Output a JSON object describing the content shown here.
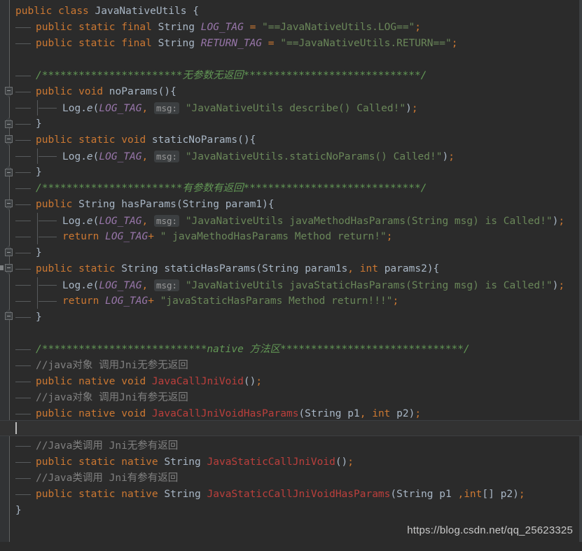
{
  "editor": {
    "theme": "Darcula",
    "file_class": "JavaNativeUtils",
    "colors": {
      "background": "#2B2B2B",
      "gutter": "#313335",
      "caret_line": "#323232",
      "keyword": "#CC7832",
      "string": "#6A8759",
      "comment_block": "#629755",
      "comment_line": "#808080",
      "field_static": "#9876AA",
      "native_method": "#BC3F3C",
      "default_text": "#A9B7C6",
      "param_hint": "#9A9A9A"
    },
    "lines": [
      {
        "n": 1,
        "indent": 0,
        "text": "public class JavaNativeUtils {"
      },
      {
        "n": 2,
        "indent": 1,
        "text": "public static final String LOG_TAG = \"==JavaNativeUtils.LOG==\";"
      },
      {
        "n": 3,
        "indent": 1,
        "text": "public static final String RETURN_TAG = \"==JavaNativeUtils.RETURN==\";"
      },
      {
        "n": 4,
        "indent": 1,
        "text": ""
      },
      {
        "n": 5,
        "indent": 1,
        "text": "/***********************无参数无返回*****************************/"
      },
      {
        "n": 6,
        "indent": 1,
        "text": "public void noParams(){"
      },
      {
        "n": 7,
        "indent": 2,
        "text": "Log.e(LOG_TAG, msg: \"JavaNativeUtils describe() Called!\");"
      },
      {
        "n": 8,
        "indent": 1,
        "text": "}"
      },
      {
        "n": 9,
        "indent": 1,
        "text": "public static void staticNoParams(){"
      },
      {
        "n": 10,
        "indent": 2,
        "text": "Log.e(LOG_TAG, msg: \"JavaNativeUtils.staticNoParams() Called!\");"
      },
      {
        "n": 11,
        "indent": 1,
        "text": "}"
      },
      {
        "n": 12,
        "indent": 1,
        "text": "/***********************有参数有返回*****************************/"
      },
      {
        "n": 13,
        "indent": 1,
        "text": "public String hasParams(String param1){"
      },
      {
        "n": 14,
        "indent": 2,
        "text": "Log.e(LOG_TAG, msg: \"JavaNativeUtils javaMethodHasParams(String msg) is Called!\");"
      },
      {
        "n": 15,
        "indent": 2,
        "text": "return LOG_TAG+ \" javaMethodHasParams Method return!\";"
      },
      {
        "n": 16,
        "indent": 1,
        "text": "}"
      },
      {
        "n": 17,
        "indent": 1,
        "text": "public static String staticHasParams(String param1s, int params2){"
      },
      {
        "n": 18,
        "indent": 2,
        "text": "Log.e(LOG_TAG, msg: \"JavaNativeUtils javaStaticHasParams(String msg) is Called!\");"
      },
      {
        "n": 19,
        "indent": 2,
        "text": "return LOG_TAG+ \"javaStaticHasParams Method return!!!\";"
      },
      {
        "n": 20,
        "indent": 1,
        "text": "}"
      },
      {
        "n": 21,
        "indent": 1,
        "text": ""
      },
      {
        "n": 22,
        "indent": 1,
        "text": "/***************************native 方法区******************************/"
      },
      {
        "n": 23,
        "indent": 1,
        "text": "//java对象 调用Jni无参无返回"
      },
      {
        "n": 24,
        "indent": 1,
        "text": "public native void JavaCallJniVoid();"
      },
      {
        "n": 25,
        "indent": 1,
        "text": "//java对象 调用Jni有参无返回"
      },
      {
        "n": 26,
        "indent": 1,
        "text": "public native void JavaCallJniVoidHasParams(String p1, int p2);"
      },
      {
        "n": 27,
        "indent": 1,
        "text": ""
      },
      {
        "n": 28,
        "indent": 1,
        "text": "//Java类调用 Jni无参有返回"
      },
      {
        "n": 29,
        "indent": 1,
        "text": "public static native String JavaStaticCallJniVoid();"
      },
      {
        "n": 30,
        "indent": 1,
        "text": "//Java类调用 Jni有参有返回"
      },
      {
        "n": 31,
        "indent": 1,
        "text": "public static native String JavaStaticCallJniVoidHasParams(String p1 ,int[] p2);"
      },
      {
        "n": 32,
        "indent": 0,
        "text": "}"
      }
    ],
    "tokens": {
      "l1": {
        "kw": "public",
        "kw2": "class",
        "cls": "JavaNativeUtils",
        "brace": "{"
      },
      "l2": {
        "kw": "public static final",
        "type": "String",
        "field": "LOG_TAG",
        "eq": "=",
        "str": "\"==JavaNativeUtils.LOG==\"",
        "semi": ";"
      },
      "l3": {
        "kw": "public static final",
        "type": "String",
        "field": "RETURN_TAG",
        "eq": "=",
        "str": "\"==JavaNativeUtils.RETURN==\"",
        "semi": ";"
      },
      "l5_comment_pre": "/***********************",
      "l5_comment_cn": "无参数无返回",
      "l5_comment_post": "*****************************/",
      "l12_comment_pre": "/***********************",
      "l12_comment_cn": "有参数有返回",
      "l12_comment_post": "*****************************/",
      "l22_comment_pre": "/***************************",
      "l22_comment_native": "native",
      "l22_comment_cn": " 方法区",
      "l22_comment_post": "******************************/",
      "hint_label": "msg:"
    },
    "caret": {
      "line": 27,
      "column": 1
    }
  },
  "watermark": {
    "text": "https://blog.csdn.net/qq_25623325"
  }
}
